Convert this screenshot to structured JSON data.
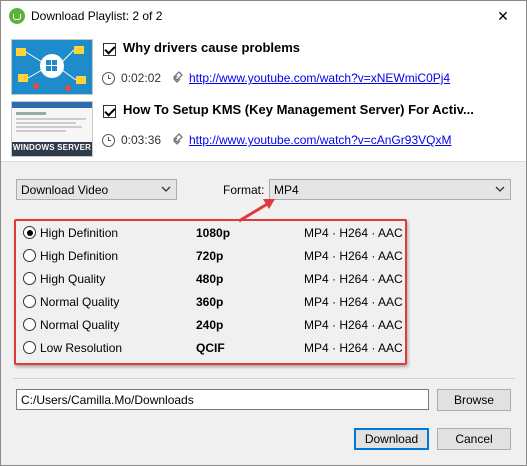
{
  "window": {
    "title": "Download Playlist: 2 of 2",
    "close_label": "✕"
  },
  "videos": [
    {
      "title": "Why drivers cause problems",
      "checked": true,
      "duration": "0:02:02",
      "url": "http://www.youtube.com/watch?v=xNEWmiC0Pj4"
    },
    {
      "title": "How To Setup KMS (Key Management Server) For Activ...",
      "checked": true,
      "duration": "0:03:36",
      "url": "http://www.youtube.com/watch?v=cAnGr93VQxM",
      "thumbnail_text": "WINDOWS SERVER"
    }
  ],
  "options": {
    "mode_select": "Download Video",
    "format_label": "Format:",
    "format_select": "MP4"
  },
  "qualities": [
    {
      "name": "High Definition",
      "resolution": "1080p",
      "format": "MP4 · H264 · AAC",
      "selected": true
    },
    {
      "name": "High Definition",
      "resolution": "720p",
      "format": "MP4 · H264 · AAC",
      "selected": false
    },
    {
      "name": "High Quality",
      "resolution": "480p",
      "format": "MP4 · H264 · AAC",
      "selected": false
    },
    {
      "name": "Normal Quality",
      "resolution": "360p",
      "format": "MP4 · H264 · AAC",
      "selected": false
    },
    {
      "name": "Normal Quality",
      "resolution": "240p",
      "format": "MP4 · H264 · AAC",
      "selected": false
    },
    {
      "name": "Low Resolution",
      "resolution": "QCIF",
      "format": "MP4 · H264 · AAC",
      "selected": false
    }
  ],
  "destination": {
    "path": "C:/Users/Camilla.Mo/Downloads",
    "browse_label": "Browse"
  },
  "actions": {
    "download_label": "Download",
    "cancel_label": "Cancel"
  },
  "colors": {
    "highlight_box": "#e03a3a",
    "link": "#0000ee",
    "primary_border": "#0078d7"
  }
}
